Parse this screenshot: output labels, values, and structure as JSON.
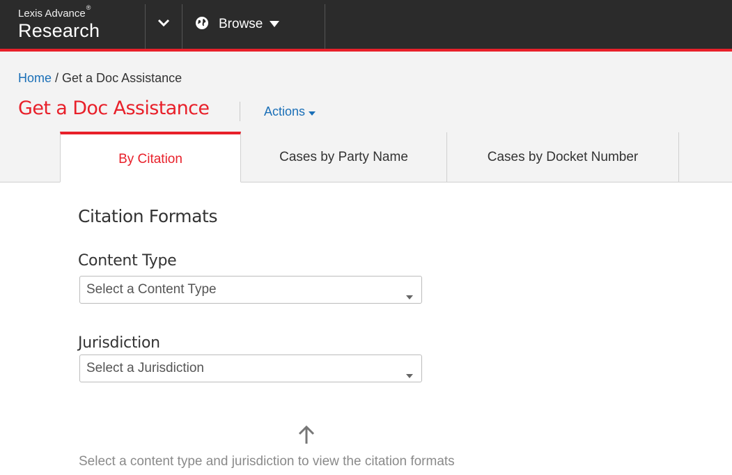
{
  "topbar": {
    "brand_line1": "Lexis Advance",
    "brand_mark": "®",
    "brand_line2": "Research",
    "browse_label": "Browse"
  },
  "breadcrumb": {
    "home": "Home",
    "separator": " / ",
    "current": "Get a Doc Assistance"
  },
  "page": {
    "title": "Get a Doc Assistance",
    "actions_label": "Actions"
  },
  "tabs": [
    {
      "label": "By Citation",
      "active": true
    },
    {
      "label": "Cases by Party Name",
      "active": false
    },
    {
      "label": "Cases by Docket Number",
      "active": false
    }
  ],
  "content": {
    "section_title": "Citation Formats",
    "content_type_label": "Content Type",
    "content_type_value": "Select a Content Type",
    "jurisdiction_label": "Jurisdiction",
    "jurisdiction_value": "Select a Jurisdiction",
    "hint": "Select a content type and jurisdiction to view the citation formats"
  },
  "colors": {
    "accent_red": "#e8202a",
    "link_blue": "#1a6fb7",
    "topbar_bg": "#2b2b2b",
    "header_bg": "#f3f3f3"
  },
  "icons": {
    "nav_caret": "chevron-down-icon",
    "browse_globe": "globe-icon",
    "browse_caret": "caret-down-icon",
    "actions_caret": "caret-down-icon",
    "select_caret": "caret-down-icon",
    "hint": "arrow-up-icon"
  }
}
